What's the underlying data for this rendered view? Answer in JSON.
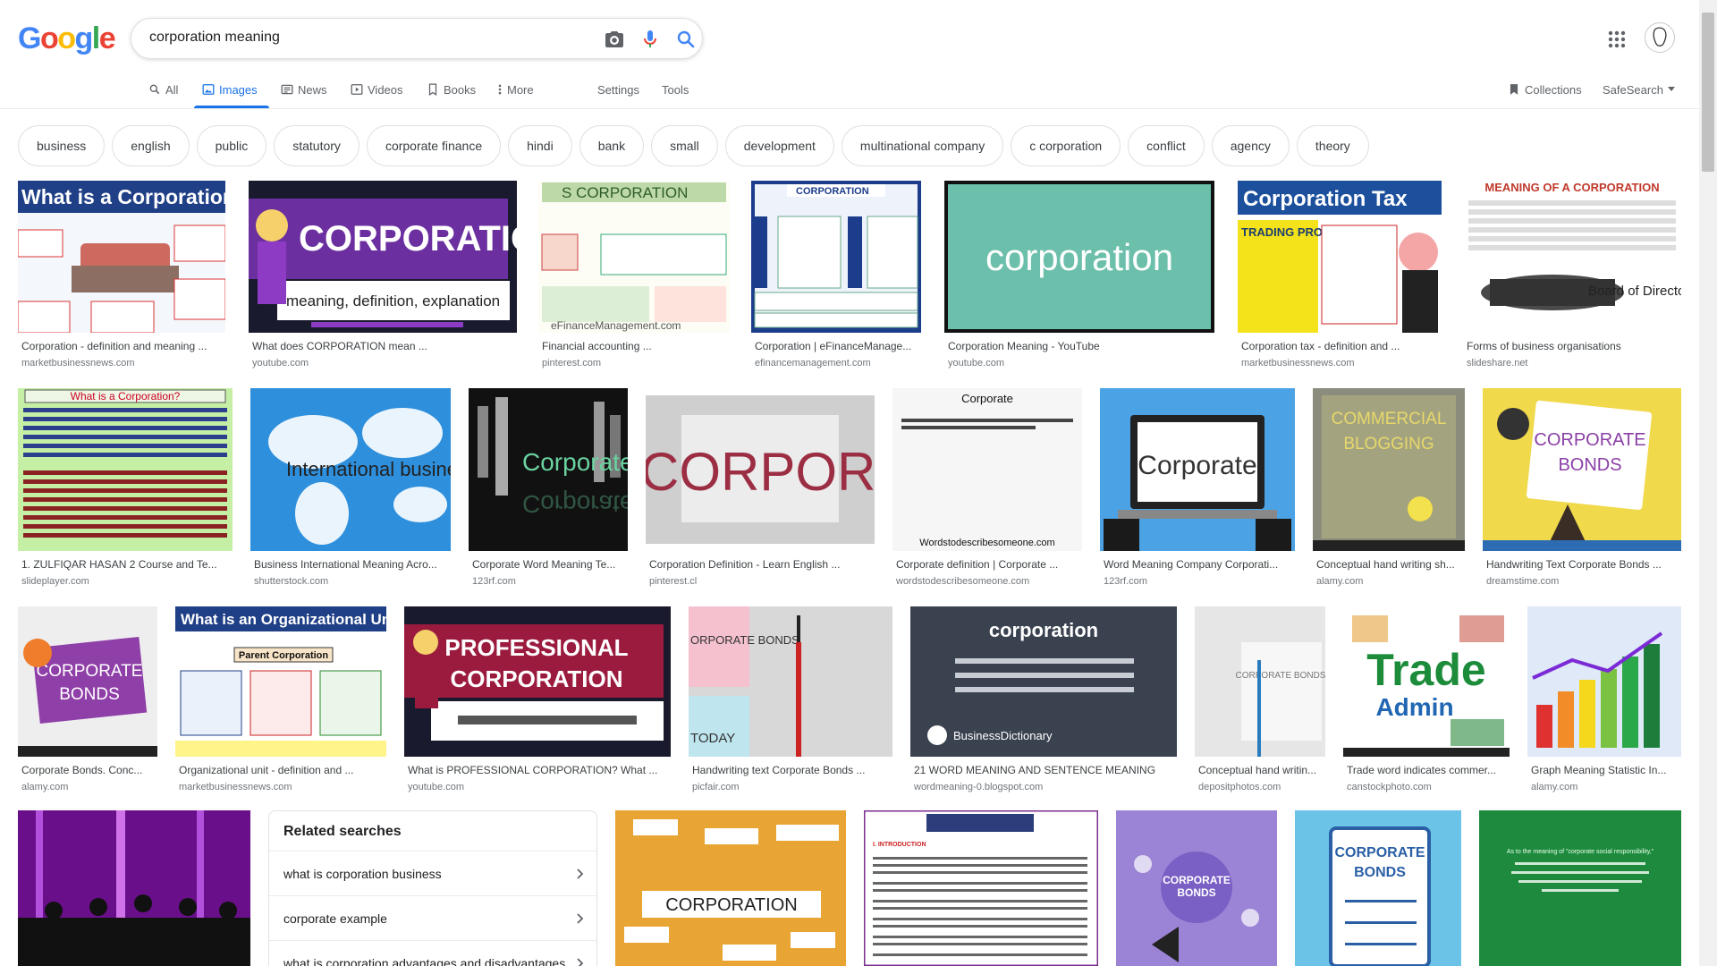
{
  "logo": {
    "letters": [
      "G",
      "o",
      "o",
      "g",
      "l",
      "e"
    ],
    "colors": [
      "#4285f4",
      "#ea4335",
      "#fbbc05",
      "#4285f4",
      "#34a853",
      "#ea4335"
    ]
  },
  "search": {
    "query": "corporation meaning"
  },
  "tabs": {
    "all": "All",
    "images": "Images",
    "news": "News",
    "videos": "Videos",
    "books": "Books",
    "more": "More",
    "settings": "Settings",
    "tools": "Tools",
    "collections": "Collections",
    "safesearch": "SafeSearch"
  },
  "chips": [
    "business",
    "english",
    "public",
    "statutory",
    "corporate finance",
    "hindi",
    "bank",
    "small",
    "development",
    "multinational company",
    "c corporation",
    "conflict",
    "agency",
    "theory"
  ],
  "results": [
    {
      "cap": "Corporation - definition and meaning ...",
      "src": "marketbusinessnews.com",
      "text": "What is a Corporation?"
    },
    {
      "cap": "What does CORPORATION mean ...",
      "src": "youtube.com",
      "text": "CORPORATION",
      "text2": "meaning, definition, explanation"
    },
    {
      "cap": "Financial accounting ...",
      "src": "pinterest.com",
      "text": "S CORPORATION",
      "text2": "eFinanceManagement.com"
    },
    {
      "cap": "Corporation | eFinanceManage...",
      "src": "efinancemanagement.com",
      "text": "CORPORATION"
    },
    {
      "cap": "Corporation Meaning - YouTube",
      "src": "youtube.com",
      "text": "corporation"
    },
    {
      "cap": "Corporation tax - definition and ...",
      "src": "marketbusinessnews.com",
      "text": "Corporation Tax",
      "text2": "TRADING PROFITS"
    },
    {
      "cap": "Forms of business organisations",
      "src": "slideshare.net",
      "text": "MEANING OF A CORPORATION",
      "text2": "Board of Directors"
    },
    {
      "cap": "1. ZULFIQAR HASAN 2 Course and Te...",
      "src": "slideplayer.com",
      "text": "What is a Corporation?"
    },
    {
      "cap": "Business International Meaning Acro...",
      "src": "shutterstock.com",
      "text": "International business"
    },
    {
      "cap": "Corporate Word Meaning Te...",
      "src": "123rf.com",
      "text": "Corporate"
    },
    {
      "cap": "Corporation Definition - Learn English ...",
      "src": "pinterest.cl",
      "text": "CORPORATIO"
    },
    {
      "cap": "Corporate definition | Corporate ...",
      "src": "wordstodescribesomeone.com",
      "text": "Corporate",
      "text2": "Wordstodescribesomeone.com"
    },
    {
      "cap": "Word Meaning Company Corporati...",
      "src": "123rf.com",
      "text": "Corporate"
    },
    {
      "cap": "Conceptual hand writing sh...",
      "src": "alamy.com",
      "text": "COMMERCIAL",
      "text2": "BLOGGING"
    },
    {
      "cap": "Handwriting Text Corporate Bonds ...",
      "src": "dreamstime.com",
      "text": "CORPORATE",
      "text2": "BONDS"
    },
    {
      "cap": "Corporate Bonds. Conc...",
      "src": "alamy.com",
      "text": "CORPORATE",
      "text2": "BONDS"
    },
    {
      "cap": "Organizational unit - definition and ...",
      "src": "marketbusinessnews.com",
      "text": "What is an Organizational Unit?",
      "text2": "Parent Corporation"
    },
    {
      "cap": "What is PROFESSIONAL CORPORATION? What ...",
      "src": "youtube.com",
      "text": "PROFESSIONAL",
      "text2": "CORPORATION"
    },
    {
      "cap": "Handwriting text Corporate Bonds ...",
      "src": "picfair.com",
      "text": "ORPORATE BONDS",
      "text2": "TODAY"
    },
    {
      "cap": "21 WORD MEANING AND SENTENCE MEANING",
      "src": "wordmeaning-0.blogspot.com",
      "text": "corporation",
      "text2": "BusinessDictionary"
    },
    {
      "cap": "Conceptual hand writin...",
      "src": "depositphotos.com",
      "text": "CORPORATE BONDS"
    },
    {
      "cap": "Trade word indicates commer...",
      "src": "canstockphoto.com",
      "text": "Trade",
      "text2": "Admin"
    },
    {
      "cap": "Graph Meaning Statistic In...",
      "src": "alamy.com",
      "text": ""
    },
    {
      "cap": "",
      "src": "",
      "text": ""
    },
    {
      "cap": "",
      "src": "",
      "text": "CORPORATION"
    },
    {
      "cap": "",
      "src": "",
      "text": "I. INTRODUCTION"
    },
    {
      "cap": "",
      "src": "",
      "text": "CORPORATE",
      "text2": "BONDS"
    },
    {
      "cap": "",
      "src": "",
      "text": "CORPORATE",
      "text2": "BONDS"
    },
    {
      "cap": "",
      "src": "",
      "text": "As to the meaning of \"corporate social responsibility,\""
    }
  ],
  "related": {
    "title": "Related searches",
    "items": [
      "what is corporation business",
      "corporate example",
      "what is corporation advantages and disadvantages"
    ]
  }
}
